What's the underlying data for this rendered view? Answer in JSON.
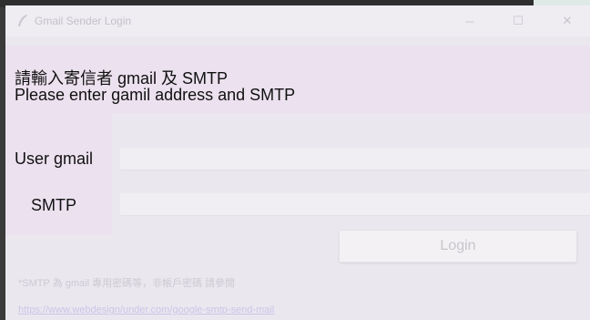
{
  "window": {
    "title": "Gmail Sender Login",
    "minimize_label": "─",
    "maximize_label": "☐",
    "close_label": "✕"
  },
  "header": {
    "line1": "請輸入寄信者 gmail 及 SMTP",
    "line2": "Please enter gamil address and SMTP"
  },
  "form": {
    "user_label": "User gmail",
    "smtp_label": "SMTP",
    "gmail_value": "",
    "smtp_value": "",
    "login_label": "Login"
  },
  "footer": {
    "note": "*SMTP 為 gmail 專用密碼等，非帳戶密碼 請參閱",
    "link": "https://www.webdesign/under.com/google-smtp-send-mail"
  },
  "icons": {
    "app": "feather-icon"
  },
  "colors": {
    "panel_highlight": "#ece1ef",
    "window_bg": "#ebe7ef"
  }
}
